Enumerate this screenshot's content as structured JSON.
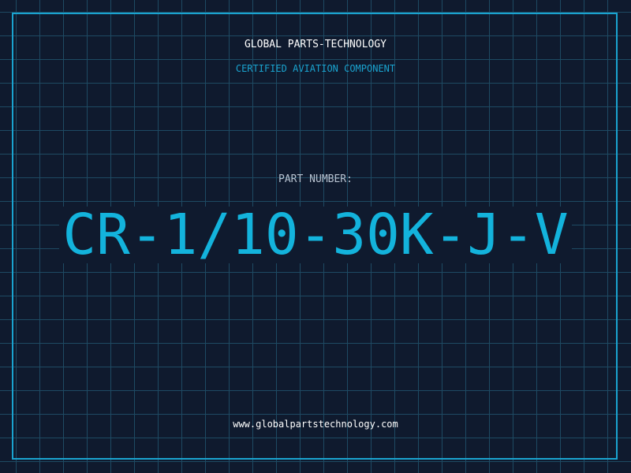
{
  "header": {
    "company": "GLOBAL PARTS-TECHNOLOGY",
    "subtitle": "CERTIFIED AVIATION COMPONENT"
  },
  "main": {
    "part_label": "PART NUMBER:",
    "part_number": "CR-1/10-30K-J-V"
  },
  "footer": {
    "website": "www.globalpartstechnology.com"
  },
  "colors": {
    "background": "#0f1a2e",
    "grid": "#1e4a63",
    "accent": "#13b3dc",
    "text": "#ffffff"
  }
}
